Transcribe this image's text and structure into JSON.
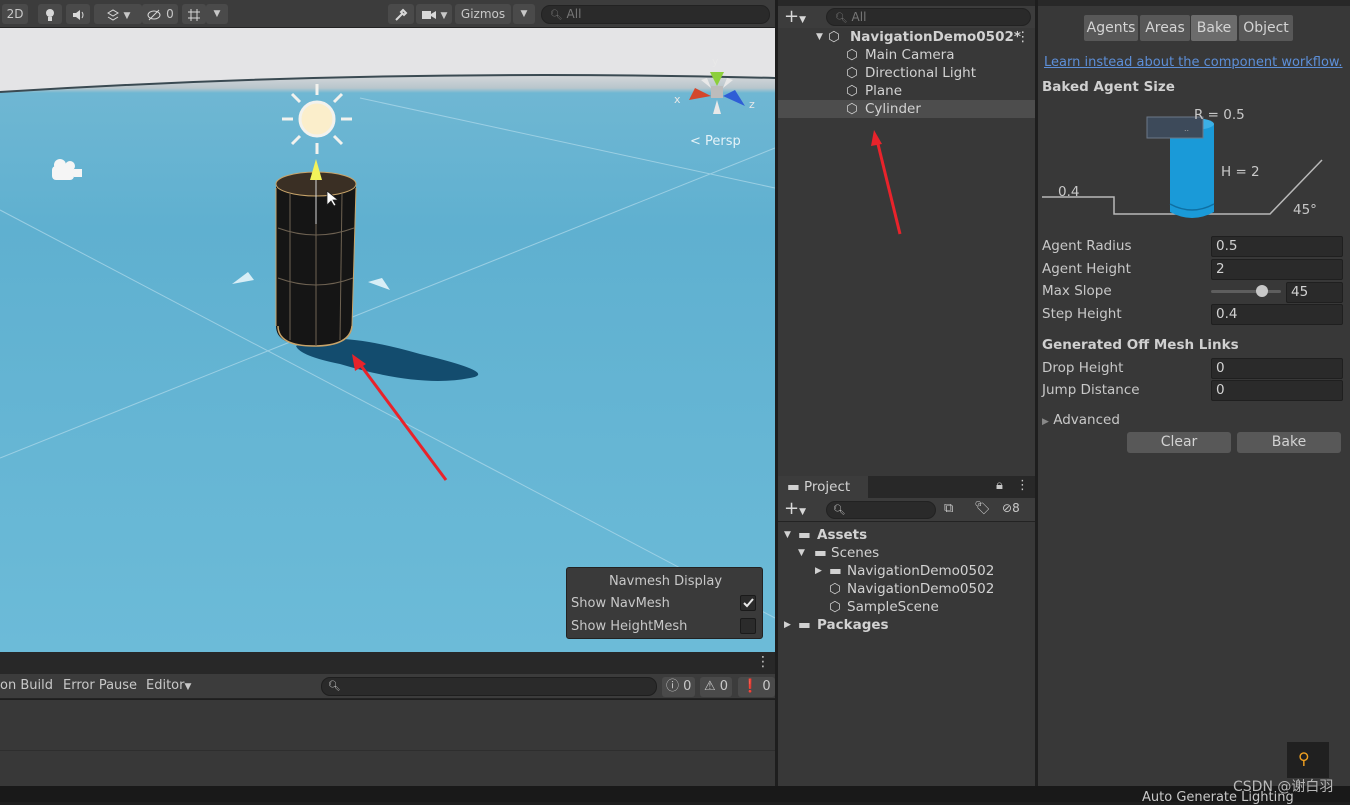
{
  "scene": {
    "toolbar": {
      "mode_2d": "2D",
      "hidden_count": "0",
      "gizmos_label": "Gizmos",
      "search_placeholder": "All"
    },
    "persp_label": "< Persp",
    "gizmo_axes": {
      "x": "x",
      "y": "y",
      "z": "z"
    },
    "navmesh_display": {
      "title": "Navmesh Display",
      "show_navmesh_label": "Show NavMesh",
      "show_navmesh_checked": true,
      "show_heightmesh_label": "Show HeightMesh",
      "show_heightmesh_checked": false
    }
  },
  "console": {
    "build_label": "on Build",
    "error_pause_label": "Error Pause",
    "editor_label": "Editor",
    "log_count": "0",
    "warning_count": "0",
    "error_count": "0"
  },
  "hierarchy": {
    "search_placeholder": "All",
    "scene_name": "NavigationDemo0502*",
    "items": [
      "Main Camera",
      "Directional Light",
      "Plane",
      "Cylinder"
    ]
  },
  "project": {
    "tab_label": "Project",
    "hidden_count": "8",
    "tree": {
      "assets": "Assets",
      "scenes": "Scenes",
      "folder": "NavigationDemo0502",
      "scene1": "NavigationDemo0502",
      "scene2": "SampleScene",
      "packages": "Packages"
    }
  },
  "navigation": {
    "tabs": [
      "Agents",
      "Areas",
      "Bake",
      "Object"
    ],
    "active_tab": "Bake",
    "link_text": "Learn instead about the component workflow.",
    "baked_agent_size_title": "Baked Agent Size",
    "diagram": {
      "r_label": "R = 0.5",
      "h_label": "H = 2",
      "step_label": "0.4",
      "slope_label": "45°"
    },
    "props": {
      "agent_radius_label": "Agent Radius",
      "agent_radius_value": "0.5",
      "agent_height_label": "Agent Height",
      "agent_height_value": "2",
      "max_slope_label": "Max Slope",
      "max_slope_value": "45",
      "step_height_label": "Step Height",
      "step_height_value": "0.4"
    },
    "offmesh_title": "Generated Off Mesh Links",
    "offmesh": {
      "drop_height_label": "Drop Height",
      "drop_height_value": "0",
      "jump_distance_label": "Jump Distance",
      "jump_distance_value": "0"
    },
    "advanced_label": "Advanced",
    "clear_button": "Clear",
    "bake_button": "Bake"
  },
  "statusbar": {
    "auto_generate": "Auto Generate Lighting"
  },
  "watermark": "CSDN @谢白羽",
  "colors": {
    "annotation_arrow": "#e8232b",
    "cylinder_blue": "#1a9ad8",
    "link_blue": "#5d8fd8"
  }
}
